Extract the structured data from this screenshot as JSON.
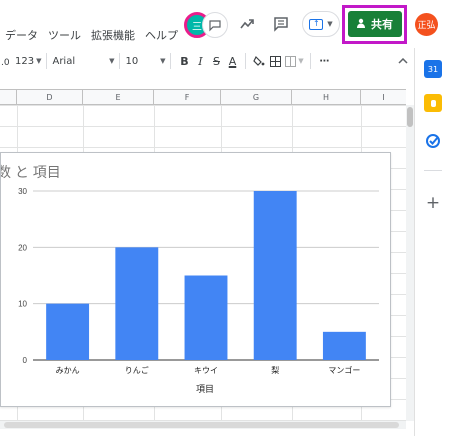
{
  "menu": [
    "データ",
    "ツール",
    "拡張機能",
    "ヘルプ"
  ],
  "header": {
    "collab_avatar_text": "三",
    "chat_icon": "chat-icon",
    "trend_icon": "trend-icon",
    "comment_icon": "comment-icon",
    "present_icon": "present-icon",
    "share_label": "共有",
    "user_avatar_text": "正弘",
    "share_color": "#188038",
    "highlight_color": "#c218c8"
  },
  "toolbar": {
    "number_format": "123",
    "font": "Arial",
    "font_size": "10",
    "bold": "B",
    "italic": "I",
    "strike": "S",
    "text_color": "A",
    "more": "⋯"
  },
  "columns": [
    "D",
    "E",
    "F",
    "G",
    "H",
    "I"
  ],
  "chart_data": {
    "type": "bar",
    "title": "数 と 項目",
    "xlabel": "項目",
    "ylabel": "",
    "categories": [
      "みかん",
      "りんご",
      "キウイ",
      "梨",
      "マンゴー"
    ],
    "values": [
      10,
      20,
      15,
      30,
      5
    ],
    "ylim": [
      0,
      30
    ],
    "yticks": [
      "0",
      "10",
      "20",
      "30"
    ],
    "bar_color": "#4285f4",
    "grid": true
  }
}
